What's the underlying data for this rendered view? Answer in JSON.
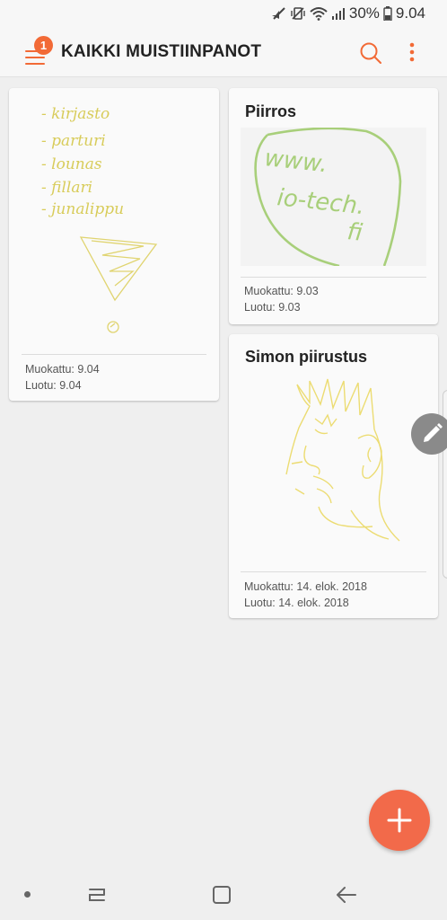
{
  "status_bar": {
    "battery": "30%",
    "time": "9.04",
    "icons": [
      "mute-icon",
      "vibrate-icon",
      "wifi-icon",
      "signal-icon",
      "battery-icon"
    ]
  },
  "app_bar": {
    "title": "KAIKKI MUISTIINPANOT",
    "notification_count": "1",
    "icons": [
      "menu-icon",
      "search-icon",
      "more-vert-icon"
    ],
    "accent_color": "#f26a36"
  },
  "notes": [
    {
      "title": "",
      "handwriting": [
        "- kirjasto",
        "- parturi",
        "- lounas",
        "- fillari",
        "- junalippu"
      ],
      "modified": "Muokattu: 9.04",
      "created": "Luotu: 9.04"
    },
    {
      "title": "Piirros",
      "handwriting": [
        "www.",
        "io-tech.",
        "fi"
      ],
      "modified": "Muokattu: 9.03",
      "created": "Luotu: 9.03"
    },
    {
      "title": "Simon piirustus",
      "handwriting": [],
      "modified": "Muokattu: 14. elok. 2018",
      "created": "Luotu: 14. elok. 2018"
    }
  ],
  "fab": {
    "icon": "plus-icon",
    "color": "#f26a4a"
  },
  "edge": {
    "icon": "pen-icon"
  },
  "nav_bar": {
    "icons": [
      "dot-icon",
      "recents-icon",
      "home-icon",
      "back-icon"
    ]
  }
}
